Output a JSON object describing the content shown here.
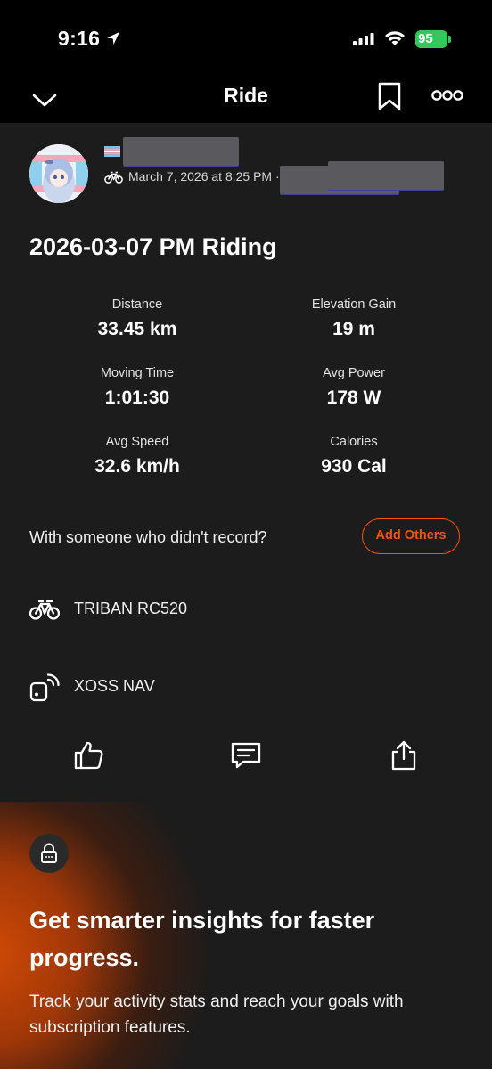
{
  "status_bar": {
    "time": "9:16",
    "battery": "95"
  },
  "nav": {
    "title": "Ride"
  },
  "activity": {
    "date_time": "March 7, 2026 at 8:25 PM ·",
    "title": "2026-03-07 PM Riding"
  },
  "stats": [
    {
      "label": "Distance",
      "value": "33.45 km"
    },
    {
      "label": "Elevation Gain",
      "value": "19 m"
    },
    {
      "label": "Moving Time",
      "value": "1:01:30"
    },
    {
      "label": "Avg Power",
      "value": "178 W"
    },
    {
      "label": "Avg Speed",
      "value": "32.6 km/h"
    },
    {
      "label": "Calories",
      "value": "930 Cal"
    }
  ],
  "with_someone": {
    "prompt": "With someone who didn't record?",
    "button": "Add Others"
  },
  "gear": {
    "bike": "TRIBAN RC520",
    "device": "XOSS NAV"
  },
  "promo": {
    "heading": "Get smarter insights for faster progress.",
    "body": "Track your activity stats and reach your goals with subscription features."
  },
  "colors": {
    "accent": "#fc5200",
    "battery": "#34c759",
    "background": "#1c1c1c"
  }
}
